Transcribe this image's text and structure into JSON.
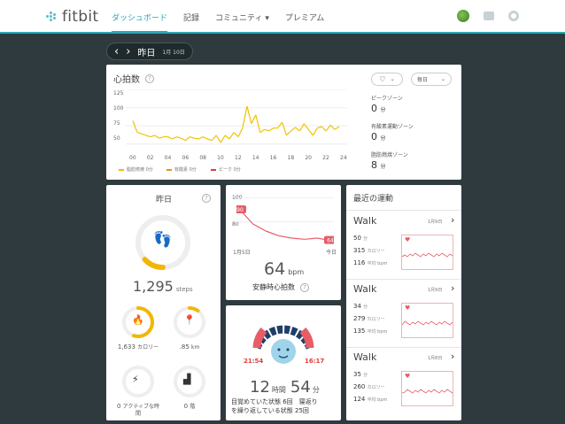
{
  "nav": {
    "logo": "fitbit",
    "items": [
      "ダッシュボード",
      "記録",
      "コミュニティ ▾",
      "プレミアム"
    ]
  },
  "datebar": {
    "prev": "‹",
    "next": "›",
    "label": "昨日",
    "sub": "1月 10日"
  },
  "heart": {
    "title": "心拍数",
    "yticks": [
      "125",
      "100",
      "75",
      "50"
    ],
    "xticks": [
      "00",
      "02",
      "04",
      "06",
      "08",
      "10",
      "12",
      "14",
      "16",
      "18",
      "20",
      "22",
      "24"
    ],
    "legend": [
      {
        "label": "脂肪燃焼 0分",
        "color": "#f2b705"
      },
      {
        "label": "有酸素 0分",
        "color": "#f28c1c"
      },
      {
        "label": "ピーク 0分",
        "color": "#e23b3b"
      }
    ],
    "range_pill": "毎日",
    "zones": [
      {
        "label": "ピークゾーン",
        "value": "0",
        "unit": "分"
      },
      {
        "label": "有酸素運動ゾーン",
        "value": "0",
        "unit": "分"
      },
      {
        "label": "脂肪燃焼ゾーン",
        "value": "8",
        "unit": "分"
      }
    ],
    "chart_data": {
      "type": "line",
      "x": [
        0,
        0.5,
        1,
        1.5,
        2,
        2.5,
        3,
        3.5,
        4,
        4.5,
        5,
        5.5,
        6,
        6.5,
        7,
        7.5,
        8,
        8.5,
        9,
        9.5,
        10,
        10.5,
        11,
        11.5,
        12,
        12.5,
        13,
        13.5,
        14,
        14.5,
        15,
        15.5,
        16,
        16.5,
        17,
        17.5,
        18,
        18.5,
        19,
        19.5,
        20,
        20.5,
        21,
        21.5,
        22,
        22.5,
        23,
        23.5
      ],
      "values": [
        82,
        66,
        64,
        62,
        60,
        62,
        58,
        60,
        60,
        57,
        60,
        58,
        55,
        60,
        58,
        57,
        60,
        57,
        55,
        62,
        52,
        62,
        57,
        66,
        60,
        72,
        102,
        78,
        90,
        66,
        70,
        68,
        72,
        72,
        80,
        62,
        68,
        73,
        68,
        78,
        70,
        62,
        72,
        74,
        68,
        76,
        70,
        74
      ],
      "ylim": [
        40,
        125
      ],
      "xlim": [
        0,
        24
      ],
      "color": "#f2c200"
    }
  },
  "steps": {
    "title": "昨日",
    "value": "1,295",
    "unit": "steps",
    "progress": 0.13
  },
  "stats": [
    {
      "icon": "flame-icon",
      "value": "1,633",
      "unit": "カロリー",
      "progress": 0.55,
      "color": "#f2b705"
    },
    {
      "icon": "location-pin-icon",
      "value": ".85",
      "unit": "km",
      "progress": 0.1,
      "color": "#f2b705"
    },
    {
      "icon": "lightning-icon",
      "value": "0",
      "unit": "アクティブな時間",
      "progress": 0
    },
    {
      "icon": "stairs-icon",
      "value": "0",
      "unit": "階",
      "progress": 0
    }
  ],
  "resting": {
    "value": "64",
    "unit": "bpm",
    "label": "安静時心拍数",
    "start_label": "90",
    "end_label": "64",
    "yticks": [
      "100",
      "80"
    ],
    "x_start": "1月5日",
    "x_end": "今日",
    "chart_data": {
      "type": "line",
      "values": [
        90,
        78,
        72,
        68,
        66,
        65,
        66,
        64
      ],
      "ylim": [
        60,
        102
      ],
      "color": "#e85c68"
    }
  },
  "sleep": {
    "start": "21:54",
    "end": "16:17",
    "hours": "12",
    "hours_unit": "時間",
    "minutes": "54",
    "minutes_unit": "分",
    "detail1": "目覚めていた状態 6回　寝返り",
    "detail2": "を繰り返している状態 25回"
  },
  "exercise": {
    "title": "最近の運動",
    "items": [
      {
        "name": "Walk",
        "date": "1月9日",
        "duration": "50",
        "duration_unit": "分",
        "calories": "315",
        "cal_unit": "カロリー",
        "hr": "116",
        "hr_unit": "平均 bpm"
      },
      {
        "name": "Walk",
        "date": "1月9日",
        "duration": "34",
        "duration_unit": "分",
        "calories": "279",
        "cal_unit": "カロリー",
        "hr": "135",
        "hr_unit": "平均 bpm"
      },
      {
        "name": "Walk",
        "date": "1月8日",
        "duration": "35",
        "duration_unit": "分",
        "calories": "260",
        "cal_unit": "カロリー",
        "hr": "124",
        "hr_unit": "平均 bpm"
      }
    ]
  }
}
